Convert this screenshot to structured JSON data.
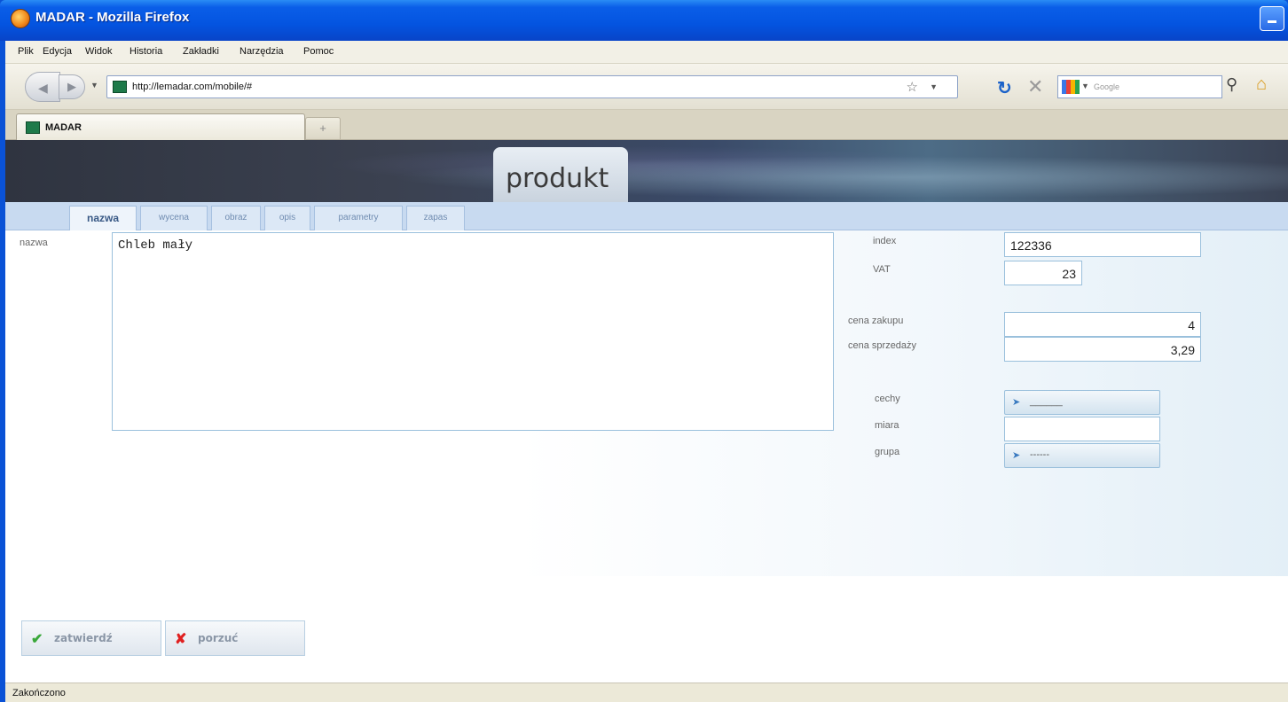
{
  "window": {
    "title": "MADAR - Mozilla Firefox"
  },
  "menubar": {
    "items": [
      "Plik",
      "Edycja",
      "Widok",
      "Historia",
      "Zakładki",
      "Narzędzia",
      "Pomoc"
    ]
  },
  "navbar": {
    "url": "http://lemadar.com/mobile/#",
    "search_placeholder": "Google"
  },
  "tabs": [
    {
      "label": "MADAR"
    }
  ],
  "page": {
    "title": "produkt",
    "subtabs": [
      "nazwa",
      "wycena",
      "obraz",
      "opis",
      "parametry",
      "zapas"
    ],
    "active_subtab": "nazwa",
    "form": {
      "nazwa_label": "nazwa",
      "nazwa_value": "Chleb mały",
      "index_label": "index",
      "index_value": "122336",
      "vat_label": "VAT",
      "vat_value": "23",
      "cena_zakupu_label": "cena zakupu",
      "cena_zakupu_value": "4",
      "cena_sprzedazy_label": "cena sprzedaży",
      "cena_sprzedazy_value": "3,29",
      "cechy_label": "cechy",
      "cechy_value": "______",
      "miara_label": "miara",
      "miara_value": "",
      "grupa_label": "grupa",
      "grupa_value": "------"
    },
    "buttons": {
      "confirm": "zatwierdź",
      "cancel": "porzuć"
    }
  },
  "status": {
    "text": "Zakończono"
  },
  "colors": {
    "confirm_icon": "#3aa83a",
    "cancel_icon": "#e02020",
    "accent": "#c8daf0"
  }
}
